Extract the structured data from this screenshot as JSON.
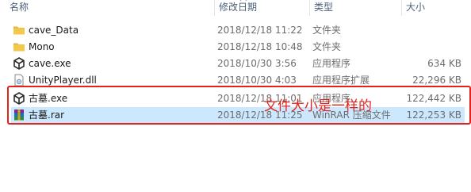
{
  "columns": {
    "name": "名称",
    "date": "修改日期",
    "type": "类型",
    "size": "大小"
  },
  "files": [
    {
      "name": "cave_Data",
      "date": "2018/12/18 11:22",
      "type": "文件夹",
      "size": "",
      "icon": "folder-icon"
    },
    {
      "name": "Mono",
      "date": "2018/12/18 10:48",
      "type": "文件夹",
      "size": "",
      "icon": "folder-icon"
    },
    {
      "name": "cave.exe",
      "date": "2018/10/30 3:56",
      "type": "应用程序",
      "size": "634 KB",
      "icon": "unity-icon"
    },
    {
      "name": "UnityPlayer.dll",
      "date": "2018/10/30 4:03",
      "type": "应用程序扩展",
      "size": "22,296 KB",
      "icon": "dll-icon"
    },
    {
      "name": "古墓.exe",
      "date": "2018/12/18 11:01",
      "type": "应用程序",
      "size": "122,442 KB",
      "icon": "unity-icon"
    },
    {
      "name": "古墓.rar",
      "date": "2018/12/18 11:25",
      "type": "WinRAR 压缩文件",
      "size": "122,253 KB",
      "icon": "winrar-icon"
    }
  ],
  "annotation": "文件大小是一样的",
  "colors": {
    "selection": "#cce8ff",
    "annotation": "#e3211d",
    "folder": "#f3c94d"
  }
}
